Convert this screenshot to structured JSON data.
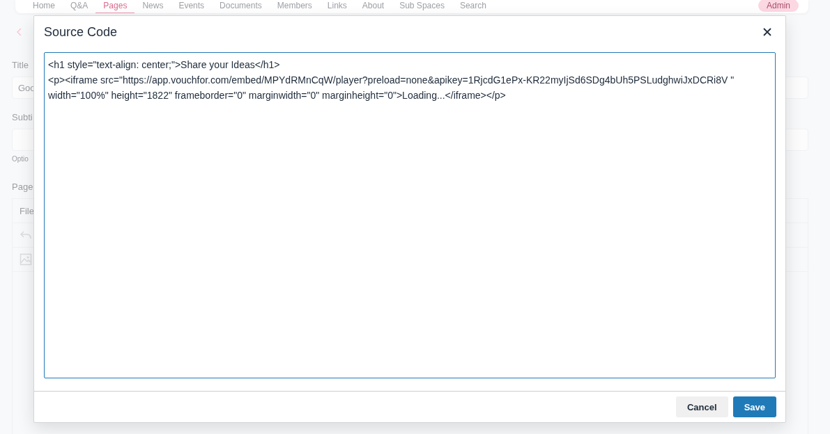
{
  "nav": {
    "items": [
      {
        "label": "Home",
        "selected": false
      },
      {
        "label": "Q&A",
        "selected": false
      },
      {
        "label": "Pages",
        "selected": true
      },
      {
        "label": "News",
        "selected": false
      },
      {
        "label": "Events",
        "selected": false
      },
      {
        "label": "Documents",
        "selected": false
      },
      {
        "label": "Members",
        "selected": false
      },
      {
        "label": "Links",
        "selected": false
      },
      {
        "label": "About",
        "selected": false
      },
      {
        "label": "Sub Spaces",
        "selected": false
      },
      {
        "label": "Search",
        "selected": false
      }
    ],
    "admin_button": "Admin"
  },
  "page": {
    "title_label": "Title",
    "title_value": "Goo",
    "subtitle_label": "Subti",
    "subtitle_hint": "Optio",
    "content_label": "Page",
    "editor_menu": "File"
  },
  "dialog": {
    "title": "Source Code",
    "code_lines": [
      "<h1 style=\"text-align: center;\">Share your Ideas</h1>",
      "<p><iframe src=\"https://app.vouchfor.com/embed/MPYdRMnCqW/player?preload=none&apikey=1RjcdG1ePx-KR22myIjSd6SDg4bUh5PSLudghwiJxDCRi8V \" width=\"100%\" height=\"1822\" frameborder=\"0\" marginwidth=\"0\" marginheight=\"0\">Loading...</iframe></p>"
    ],
    "buttons": [
      {
        "label": "Cancel",
        "kind": "secondary"
      },
      {
        "label": "Save",
        "kind": "primary"
      }
    ]
  }
}
